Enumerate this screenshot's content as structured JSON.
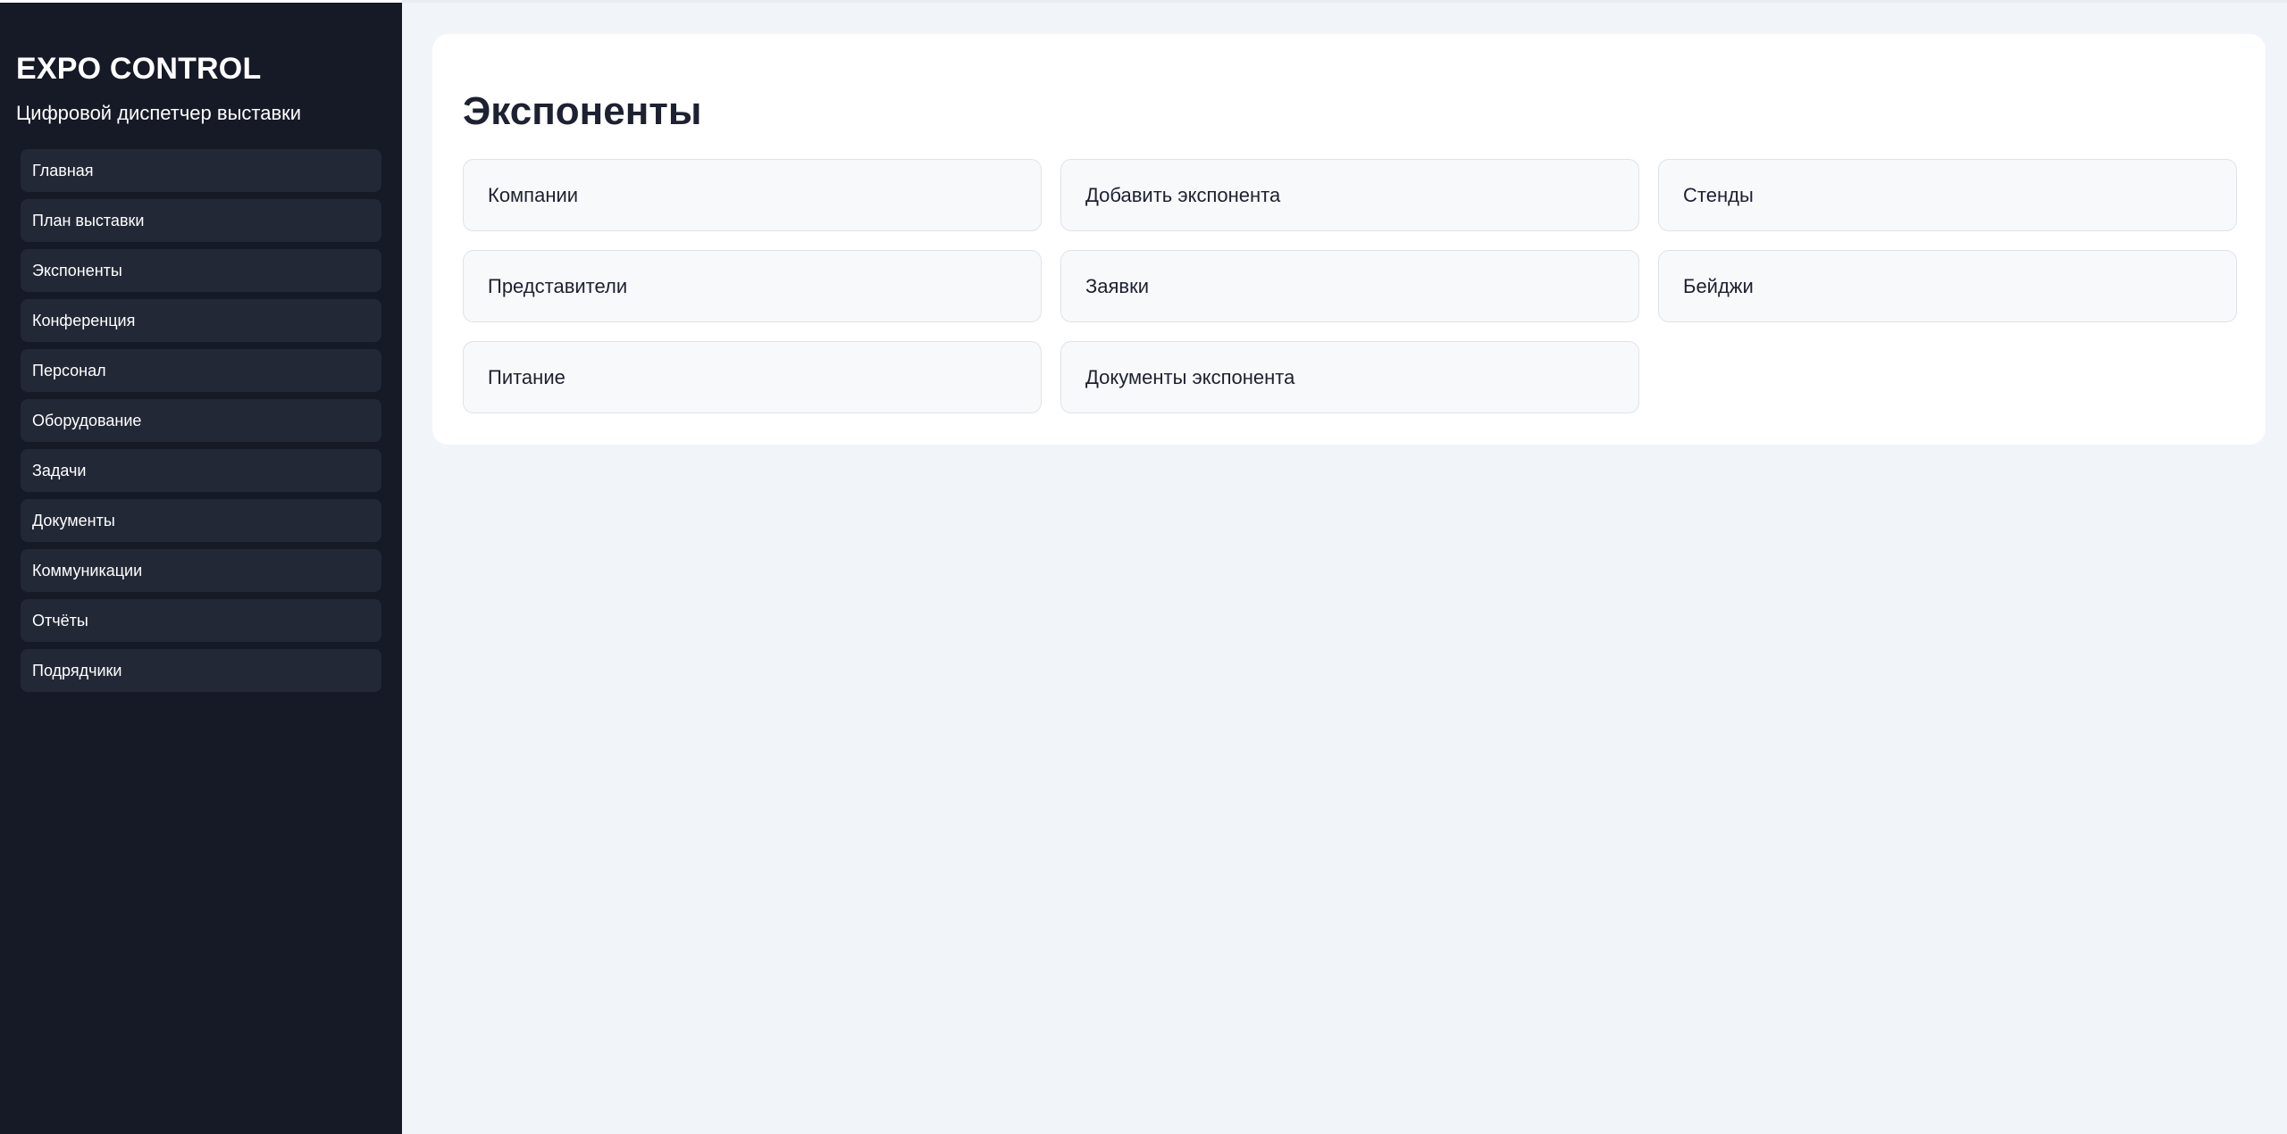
{
  "sidebar": {
    "title": "EXPO CONTROL",
    "subtitle": "Цифровой диспетчер выставки",
    "items": [
      {
        "label": "Главная"
      },
      {
        "label": "План выставки"
      },
      {
        "label": "Экспоненты"
      },
      {
        "label": "Конференция"
      },
      {
        "label": "Персонал"
      },
      {
        "label": "Оборудование"
      },
      {
        "label": "Задачи"
      },
      {
        "label": "Документы"
      },
      {
        "label": "Коммуникации"
      },
      {
        "label": "Отчёты"
      },
      {
        "label": "Подрядчики"
      }
    ]
  },
  "main": {
    "title": "Экспоненты",
    "cards": [
      {
        "label": "Компании"
      },
      {
        "label": "Добавить экспонента"
      },
      {
        "label": "Стенды"
      },
      {
        "label": "Представители"
      },
      {
        "label": "Заявки"
      },
      {
        "label": "Бейджи"
      },
      {
        "label": "Питание"
      },
      {
        "label": "Документы экспонента"
      }
    ]
  },
  "colors": {
    "sidebar_bg": "#161a27",
    "nav_item_bg": "#232836",
    "page_bg": "#f1f4f8",
    "panel_bg": "#ffffff",
    "card_bg": "#f8f9fb",
    "text_dark": "#1d2130"
  }
}
